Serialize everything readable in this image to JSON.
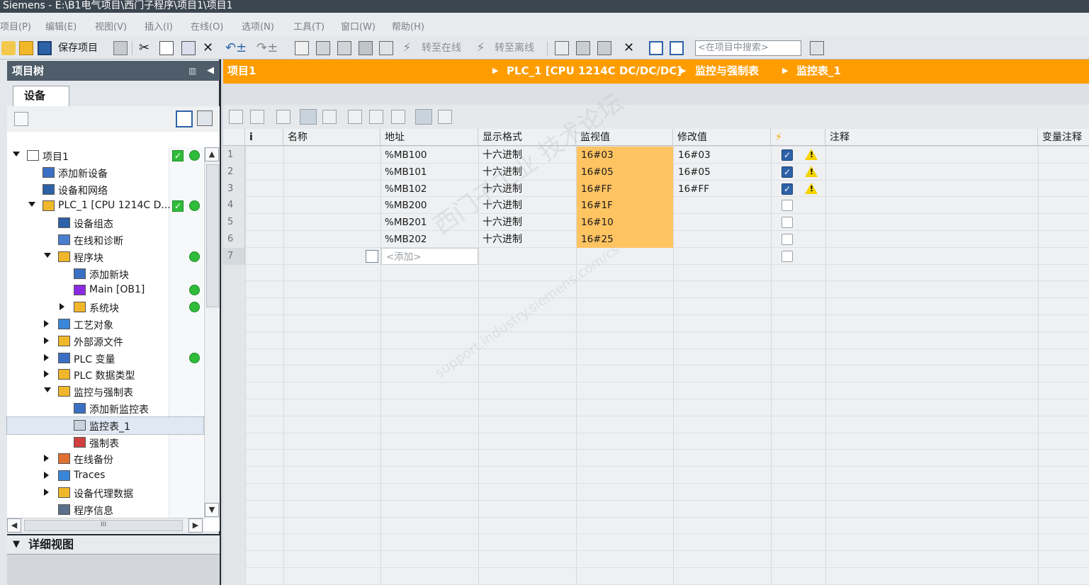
{
  "window": {
    "title": "Siemens  -  E:\\B1电气项目\\西门子程序\\项目1\\项目1"
  },
  "menu": [
    "项目(P)",
    "编辑(E)",
    "视图(V)",
    "插入(I)",
    "在线(O)",
    "选项(N)",
    "工具(T)",
    "窗口(W)",
    "帮助(H)"
  ],
  "toolbar": {
    "save_label": "保存项目",
    "go_online": "转至在线",
    "go_offline": "转至离线",
    "search_placeholder": "<在项目中搜索>"
  },
  "project_tree": {
    "header": "项目树",
    "tab": "设备",
    "items": [
      {
        "label": "项目1",
        "indent": 0,
        "expand": "down",
        "icon": "project-icon",
        "status": [
          "check",
          "dot"
        ]
      },
      {
        "label": "添加新设备",
        "indent": 1,
        "expand": "",
        "icon": "add-device-icon",
        "status": []
      },
      {
        "label": "设备和网络",
        "indent": 1,
        "expand": "",
        "icon": "network-icon",
        "status": []
      },
      {
        "label": "PLC_1 [CPU 1214C D...",
        "indent": 1,
        "expand": "down",
        "icon": "plc-icon",
        "status": [
          "check",
          "dot"
        ]
      },
      {
        "label": "设备组态",
        "indent": 2,
        "expand": "",
        "icon": "device-config-icon",
        "status": []
      },
      {
        "label": "在线和诊断",
        "indent": 2,
        "expand": "",
        "icon": "diagnostics-icon",
        "status": []
      },
      {
        "label": "程序块",
        "indent": 2,
        "expand": "down",
        "icon": "folder-icon",
        "status": [
          "dot"
        ]
      },
      {
        "label": "添加新块",
        "indent": 3,
        "expand": "",
        "icon": "add-block-icon",
        "status": []
      },
      {
        "label": "Main [OB1]",
        "indent": 3,
        "expand": "",
        "icon": "ob-block-icon",
        "status": [
          "dot"
        ]
      },
      {
        "label": "系统块",
        "indent": 3,
        "expand": "right",
        "icon": "folder-icon",
        "status": [
          "dot"
        ]
      },
      {
        "label": "工艺对象",
        "indent": 2,
        "expand": "right",
        "icon": "tech-object-icon",
        "status": []
      },
      {
        "label": "外部源文件",
        "indent": 2,
        "expand": "right",
        "icon": "source-file-icon",
        "status": []
      },
      {
        "label": "PLC 变量",
        "indent": 2,
        "expand": "right",
        "icon": "tag-table-icon",
        "status": [
          "dot"
        ]
      },
      {
        "label": "PLC 数据类型",
        "indent": 2,
        "expand": "right",
        "icon": "data-type-icon",
        "status": []
      },
      {
        "label": "监控与强制表",
        "indent": 2,
        "expand": "down",
        "icon": "folder-icon",
        "status": []
      },
      {
        "label": "添加新监控表",
        "indent": 3,
        "expand": "",
        "icon": "add-watch-table-icon",
        "status": []
      },
      {
        "label": "监控表_1",
        "indent": 3,
        "expand": "",
        "icon": "watch-table-icon",
        "status": [],
        "selected": true
      },
      {
        "label": "强制表",
        "indent": 3,
        "expand": "",
        "icon": "force-table-icon",
        "status": []
      },
      {
        "label": "在线备份",
        "indent": 2,
        "expand": "right",
        "icon": "backup-icon",
        "status": []
      },
      {
        "label": "Traces",
        "indent": 2,
        "expand": "right",
        "icon": "trace-icon",
        "status": []
      },
      {
        "label": "设备代理数据",
        "indent": 2,
        "expand": "right",
        "icon": "proxy-data-icon",
        "status": []
      },
      {
        "label": "程序信息",
        "indent": 2,
        "expand": "",
        "icon": "program-info-icon",
        "status": []
      }
    ],
    "scroll_thumb": "III"
  },
  "detail_view": {
    "label": "详细视图"
  },
  "breadcrumb": [
    "项目1",
    "PLC_1 [CPU 1214C DC/DC/DC]",
    "监控与强制表",
    "监控表_1"
  ],
  "watch_table": {
    "columns": [
      "i",
      "名称",
      "地址",
      "显示格式",
      "监视值",
      "修改值",
      "⚡",
      "注释",
      "变量注释"
    ],
    "rows": [
      {
        "no": "1",
        "address": "%MB100",
        "format": "十六进制",
        "monitor": "16#03",
        "modify": "16#03",
        "checked": true,
        "warning": true
      },
      {
        "no": "2",
        "address": "%MB101",
        "format": "十六进制",
        "monitor": "16#05",
        "modify": "16#05",
        "checked": true,
        "warning": true
      },
      {
        "no": "3",
        "address": "%MB102",
        "format": "十六进制",
        "monitor": "16#FF",
        "modify": "16#FF",
        "checked": true,
        "warning": true
      },
      {
        "no": "4",
        "address": "%MB200",
        "format": "十六进制",
        "monitor": "16#1F",
        "modify": "",
        "checked": false,
        "warning": false
      },
      {
        "no": "5",
        "address": "%MB201",
        "format": "十六进制",
        "monitor": "16#10",
        "modify": "",
        "checked": false,
        "warning": false
      },
      {
        "no": "6",
        "address": "%MB202",
        "format": "十六进制",
        "monitor": "16#25",
        "modify": "",
        "checked": false,
        "warning": false
      }
    ],
    "new_row": {
      "no": "7",
      "placeholder": "<添加>"
    }
  },
  "watermark": {
    "line1": "西门子工业 技术论坛",
    "line2": "support.industry.siemens.com/cs"
  },
  "colors": {
    "accent": "#ff9d00",
    "monitor_cell": "#ffc462",
    "status_green": "#2fbc3a",
    "checkbox_blue": "#2e62a8"
  }
}
